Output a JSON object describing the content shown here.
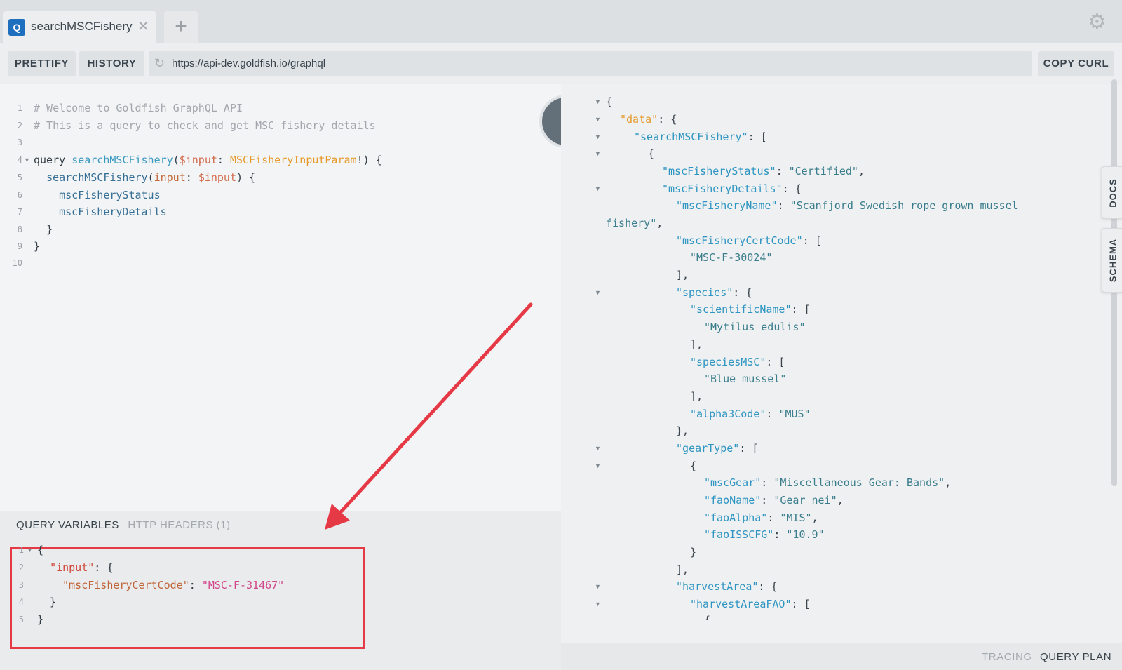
{
  "tab": {
    "icon_letter": "Q",
    "title": "searchMSCFishery",
    "close_glyph": "✕",
    "new_tab_glyph": "+"
  },
  "toolbar": {
    "prettify": "PRETTIFY",
    "history": "HISTORY",
    "url": "https://api-dev.goldfish.io/graphql",
    "copy_curl": "COPY CURL"
  },
  "editor": {
    "comment_1": "# Welcome to Goldfish GraphQL API",
    "comment_2": "# This is a query to check and get MSC fishery details",
    "kw_query": "query",
    "op_name": "searchMSCFishery",
    "param_var": "$input",
    "param_type": "MSCFisheryInputParam",
    "field_root": "searchMSCFishery",
    "arg_name": "input",
    "arg_var": "$input",
    "field_1": "mscFisheryStatus",
    "field_2": "mscFisheryDetails",
    "line_numbers": [
      "1",
      "2",
      "3",
      "4",
      "5",
      "6",
      "7",
      "8",
      "9",
      "10"
    ]
  },
  "variables": {
    "tab_active": "QUERY VARIABLES",
    "tab_inactive": "HTTP HEADERS (1)",
    "key_input": "\"input\"",
    "key_cert": "\"mscFisheryCertCode\"",
    "value_cert": "\"MSC-F-31467\"",
    "line_numbers": [
      "1",
      "2",
      "3",
      "4",
      "5"
    ]
  },
  "result": {
    "k_data": "\"data\"",
    "k_search": "\"searchMSCFishery\"",
    "k_status": "\"mscFisheryStatus\"",
    "v_status": "\"Certified\"",
    "k_details": "\"mscFisheryDetails\"",
    "k_name": "\"mscFisheryName\"",
    "v_name_1": "\"Scanfjord Swedish rope grown mussel",
    "v_name_2": "fishery\"",
    "k_cert": "\"mscFisheryCertCode\"",
    "v_cert": "\"MSC-F-30024\"",
    "k_species": "\"species\"",
    "k_sci": "\"scientificName\"",
    "v_sci": "\"Mytilus edulis\"",
    "k_spmsc": "\"speciesMSC\"",
    "v_spmsc": "\"Blue mussel\"",
    "k_alpha3": "\"alpha3Code\"",
    "v_alpha3": "\"MUS\"",
    "k_gear": "\"gearType\"",
    "k_mscgear": "\"mscGear\"",
    "v_mscgear": "\"Miscellaneous Gear: Bands\"",
    "k_faoname": "\"faoName\"",
    "v_faoname": "\"Gear nei\"",
    "k_faoalpha": "\"faoAlpha\"",
    "v_faoalpha": "\"MIS\"",
    "k_faoisscfg": "\"faoISSCFG\"",
    "v_faoisscfg": "\"10.9\"",
    "k_harvest": "\"harvestArea\"",
    "k_harvestfao": "\"harvestAreaFAO\""
  },
  "side_tabs": {
    "docs": "DOCS",
    "schema": "SCHEMA"
  },
  "footer": {
    "tracing": "TRACING",
    "query_plan": "QUERY PLAN"
  },
  "colors": {
    "annotation": "#e63946",
    "accent": "#1f6fbf"
  }
}
